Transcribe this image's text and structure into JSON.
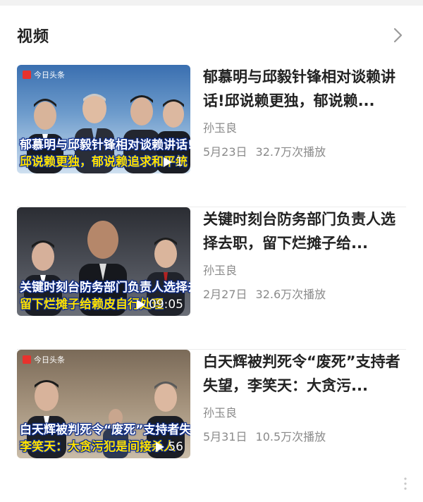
{
  "header": {
    "title": "视频",
    "more_icon": "chevron-right-icon"
  },
  "badge_text": "今日头条",
  "videos": [
    {
      "title": "郁慕明与邱毅针锋相对谈赖讲话!邱说赖更独，郁说赖...",
      "author": "孙玉良",
      "date": "5月23日",
      "views": "32.7万次播放",
      "show_badge": true,
      "caption_line1": "郁慕明与邱毅针锋相对谈赖讲话!",
      "caption_line2": "邱说赖更独，郁说赖追求和平统",
      "duration": "1",
      "colors": {
        "bg_top": "#3a6fb0",
        "bg_bottom": "#cfe0f0"
      }
    },
    {
      "title": "关键时刻台防务部门负责人选择去职，留下烂摊子给...",
      "author": "孙玉良",
      "date": "2月27日",
      "views": "32.6万次播放",
      "show_badge": false,
      "caption_line1": "关键时刻台防务部门负责人选择去职",
      "caption_line2": "留下烂摊子给赖皮自行处理",
      "duration": "09:05",
      "colors": {
        "bg_top": "#2b2d33",
        "bg_bottom": "#6b6f78"
      }
    },
    {
      "title": "白天辉被判死令“废死”支持者失望，李笑天：大贪污...",
      "author": "孙玉良",
      "date": "5月31日",
      "views": "10.5万次播放",
      "show_badge": true,
      "caption_line1": "白天辉被判死令“废死”支持者失",
      "caption_line2": "李笑天：大贪污犯是间接杀人",
      "duration": "56",
      "colors": {
        "bg_top": "#7a6a58",
        "bg_bottom": "#c9bca8"
      }
    }
  ]
}
